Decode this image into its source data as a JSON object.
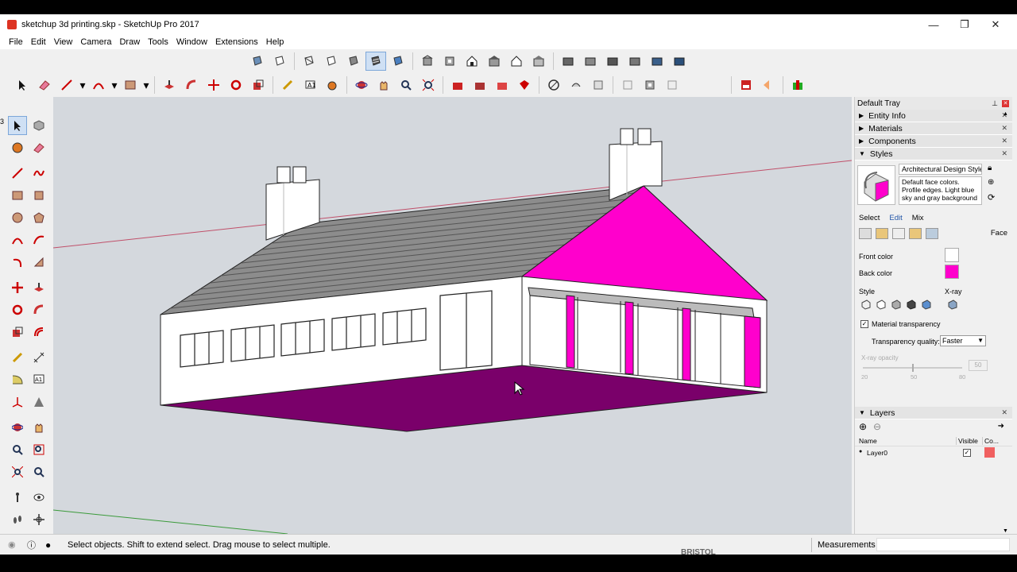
{
  "window": {
    "title": "sketchup 3d printing.skp - SketchUp Pro 2017",
    "controls": [
      "—",
      "❐",
      "✕"
    ]
  },
  "menu": [
    "File",
    "Edit",
    "View",
    "Camera",
    "Draw",
    "Tools",
    "Window",
    "Extensions",
    "Help"
  ],
  "left_edge_marker": "3",
  "default_tray": {
    "title": "Default Tray",
    "panels": {
      "entity_info": "Entity Info",
      "materials": "Materials",
      "components": "Components",
      "styles": "Styles"
    },
    "style": {
      "name": "Architectural Design Style",
      "description": "Default face colors. Profile edges. Light blue sky and gray background",
      "tabs": [
        "Select",
        "Edit",
        "Mix"
      ],
      "section_label": "Face",
      "front_color_label": "Front color",
      "back_color_label": "Back color",
      "front_color": "#ffffff",
      "back_color": "#ff00cc",
      "style_label": "Style",
      "xray_label": "X-ray",
      "material_transparency_label": "Material transparency",
      "material_transparency_checked": true,
      "transparency_quality_label": "Transparency quality:",
      "transparency_quality_value": "Faster",
      "xray_opacity_label": "X-ray opacity",
      "xray_opacity_value": "50",
      "slider_ticks": [
        "20",
        "50",
        "80"
      ]
    },
    "layers": {
      "title": "Layers",
      "col_name": "Name",
      "col_visible": "Visible",
      "col_color": "Co...",
      "rows": [
        {
          "name": "Layer0",
          "visible": true,
          "color": "#f06060"
        }
      ]
    }
  },
  "status": {
    "hint": "Select objects. Shift to extend select. Drag mouse to select multiple.",
    "measurements_label": "Measurements",
    "behind_text": "BRISTOL"
  },
  "colors": {
    "magenta_gable": "#ff00cc",
    "purple_floor": "#7a006a",
    "roof": "#8c8c8c",
    "viewport_bg": "#d4d8dd"
  }
}
